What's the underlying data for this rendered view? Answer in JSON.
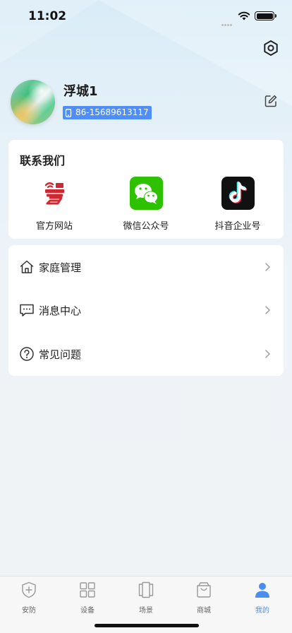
{
  "status_bar": {
    "time": "11:02"
  },
  "profile": {
    "name": "浮城1",
    "phone": "86-15689613117"
  },
  "contact": {
    "title": "联系我们",
    "items": [
      {
        "label": "官方网站",
        "icon": "official-website-icon"
      },
      {
        "label": "微信公众号",
        "icon": "wechat-icon"
      },
      {
        "label": "抖音企业号",
        "icon": "douyin-icon"
      }
    ]
  },
  "menu": {
    "items": [
      {
        "label": "家庭管理",
        "icon": "home-icon"
      },
      {
        "label": "消息中心",
        "icon": "message-icon"
      },
      {
        "label": "常见问题",
        "icon": "question-icon"
      }
    ]
  },
  "tabs": [
    {
      "label": "安防",
      "icon": "shield-icon"
    },
    {
      "label": "设备",
      "icon": "grid-icon"
    },
    {
      "label": "场景",
      "icon": "scene-icon"
    },
    {
      "label": "商城",
      "icon": "shop-bag-icon"
    },
    {
      "label": "我的",
      "icon": "user-icon",
      "active": true
    }
  ],
  "colors": {
    "accent": "#4a8ef0",
    "phone_badge": "#4f8ef7",
    "wechat_green": "#2dc100",
    "douyin_bg": "#111111",
    "website_red": "#d22630"
  }
}
